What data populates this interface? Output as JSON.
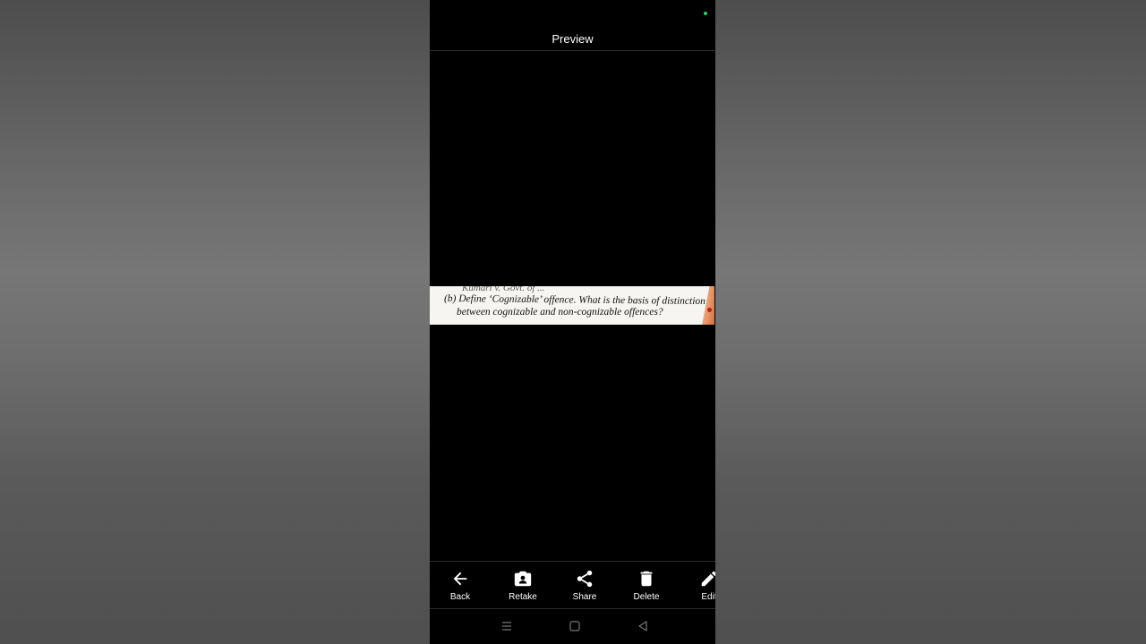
{
  "header": {
    "title": "Preview"
  },
  "scan": {
    "cut_line": "Kumari v. Govt. of ...",
    "line1": "(b)  Define ‘Cognizable’ offence.  What is the basis of distinction",
    "line2": "between cognizable and non-cognizable offences?"
  },
  "toolbar": {
    "items": [
      {
        "label": "Back",
        "icon": "arrow-left-icon"
      },
      {
        "label": "Retake",
        "icon": "camera-retake-icon"
      },
      {
        "label": "Share",
        "icon": "share-icon"
      },
      {
        "label": "Delete",
        "icon": "trash-icon"
      },
      {
        "label": "Edit",
        "icon": "pencil-icon"
      }
    ]
  },
  "navigation": {
    "buttons": [
      "menu-icon",
      "home-icon",
      "back-triangle-icon"
    ]
  },
  "colors": {
    "status_dot": "#2ecc71",
    "background": "#000000"
  }
}
